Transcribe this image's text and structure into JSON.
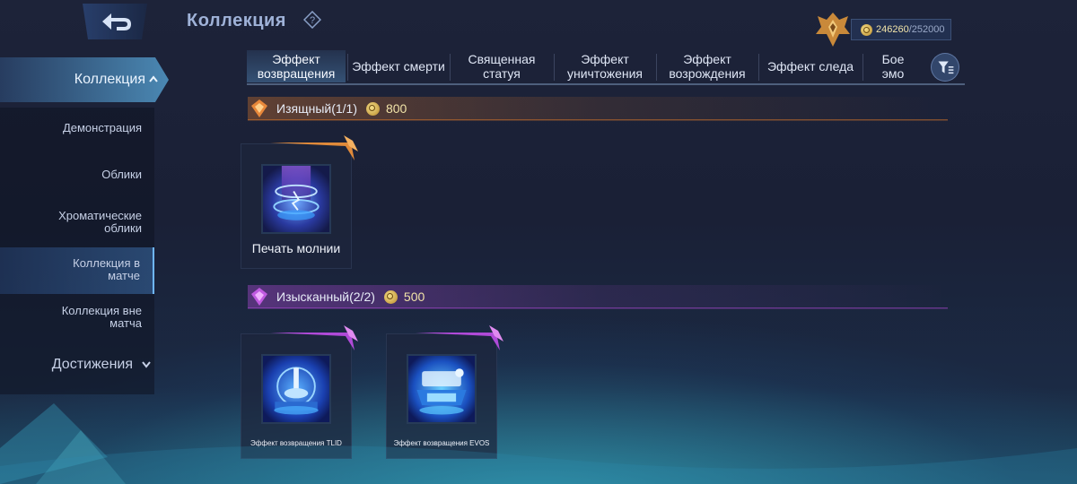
{
  "header": {
    "title": "Коллекция",
    "points_current": "246260",
    "points_sep": "/",
    "points_max": "252000"
  },
  "sidebar": {
    "main_label": "Коллекция",
    "items": [
      {
        "label": "Демонстрация"
      },
      {
        "label": "Облики"
      },
      {
        "label": "Хроматические облики"
      },
      {
        "label": "Коллекция в матче"
      },
      {
        "label": "Коллекция вне матча"
      }
    ],
    "active_index": 3,
    "achievements_label": "Достижения"
  },
  "tabs": [
    {
      "label": "Эффект возвращения"
    },
    {
      "label": "Эффект смерти"
    },
    {
      "label": "Священная статуя"
    },
    {
      "label": "Эффект уничтожения"
    },
    {
      "label": "Эффект возрождения"
    },
    {
      "label": "Эффект следа"
    },
    {
      "label": "Бое эмо"
    }
  ],
  "active_tab": 0,
  "sections": [
    {
      "title": "Изящный(1/1)",
      "price": "800",
      "accent": "#e07a2a",
      "items": [
        {
          "name": "Печать молнии"
        }
      ]
    },
    {
      "title": "Изысканный(2/2)",
      "price": "500",
      "accent": "#b04ad8",
      "items": [
        {
          "name": "Эффект возвращения TLID"
        },
        {
          "name": "Эффект возвращения EVOS"
        }
      ]
    }
  ],
  "colors": {
    "background": "#1b2138",
    "tab_active": "#5aa8e0",
    "gold": "#f1e3a8"
  },
  "icons": {
    "back": "back-arrow-icon",
    "help": "question-icon",
    "rank": "rank-emblem-icon",
    "filter": "filter-icon"
  }
}
